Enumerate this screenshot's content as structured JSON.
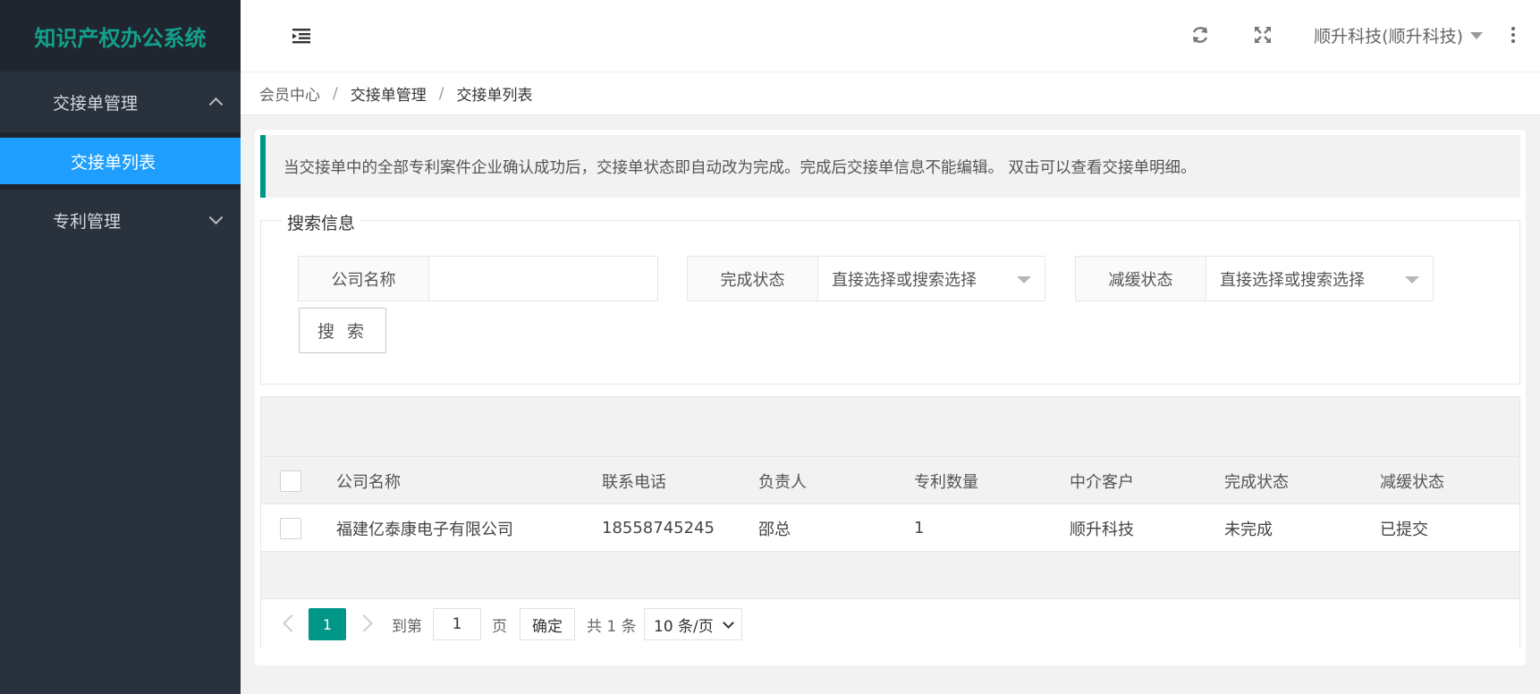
{
  "app": {
    "title": "知识产权办公系统"
  },
  "sidebar": {
    "groups": [
      {
        "label": "交接单管理",
        "expanded": true,
        "items": [
          {
            "label": "交接单列表",
            "active": true
          }
        ]
      },
      {
        "label": "专利管理",
        "expanded": false,
        "items": []
      }
    ]
  },
  "header": {
    "user": "顺升科技(顺升科技)"
  },
  "breadcrumb": {
    "items": [
      "会员中心",
      "交接单管理",
      "交接单列表"
    ],
    "separator": "/"
  },
  "notice": {
    "text": "当交接单中的全部专利案件企业确认成功后，交接单状态即自动改为完成。完成后交接单信息不能编辑。 双击可以查看交接单明细。"
  },
  "search": {
    "legend": "搜索信息",
    "company_label": "公司名称",
    "company_value": "",
    "status_label": "完成状态",
    "status_placeholder": "直接选择或搜索选择",
    "relief_label": "减缓状态",
    "relief_placeholder": "直接选择或搜索选择",
    "button_label": "搜 索"
  },
  "table": {
    "headers": [
      "公司名称",
      "联系电话",
      "负责人",
      "专利数量",
      "中介客户",
      "完成状态",
      "减缓状态"
    ],
    "rows": [
      [
        "福建亿泰康电子有限公司",
        "18558745245",
        "邵总",
        "1",
        "顺升科技",
        "未完成",
        "已提交"
      ]
    ]
  },
  "pager": {
    "current": "1",
    "goto_label": "到第",
    "goto_value": "1",
    "page_suffix": "页",
    "confirm": "确定",
    "total": "共 1 条",
    "page_size": "10 条/页"
  },
  "colors": {
    "accent": "#009688",
    "active_nav": "#1e9fff",
    "sidebar": "#28313c",
    "logo_text": "#13a08b"
  }
}
